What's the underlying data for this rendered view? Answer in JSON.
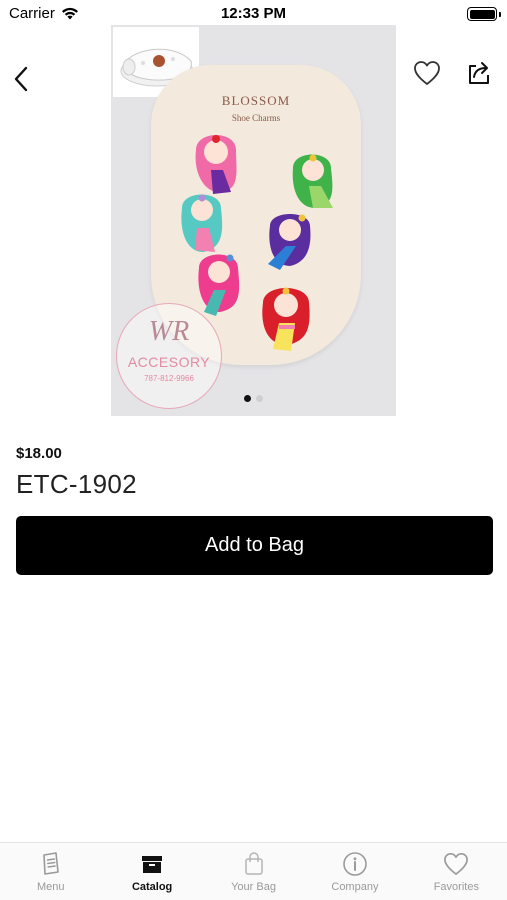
{
  "status_bar": {
    "carrier": "Carrier",
    "time": "12:33 PM"
  },
  "nav": {
    "back_icon": "chevron-left-icon",
    "favorite_icon": "heart-icon",
    "share_icon": "share-icon"
  },
  "product": {
    "card_title": "BLOSSOM",
    "card_subtitle": "Shoe Charms",
    "watermark_monogram": "WR",
    "watermark_name": "ACCESORY",
    "watermark_phone": "787-812-9966",
    "image_count": 2,
    "current_image": 1,
    "price": "$18.00",
    "name": "ETC-1902",
    "add_button_label": "Add to Bag"
  },
  "tabs": [
    {
      "label": "Menu",
      "icon": "menu-book-icon",
      "active": false
    },
    {
      "label": "Catalog",
      "icon": "catalog-box-icon",
      "active": true
    },
    {
      "label": "Your Bag",
      "icon": "bag-icon",
      "active": false
    },
    {
      "label": "Company",
      "icon": "info-icon",
      "active": false
    },
    {
      "label": "Favorites",
      "icon": "heart-icon",
      "active": false
    }
  ],
  "colors": {
    "accent": "#000000",
    "inactive_tab": "#9a9a9a",
    "watermark_pink": "#e48aa3"
  }
}
